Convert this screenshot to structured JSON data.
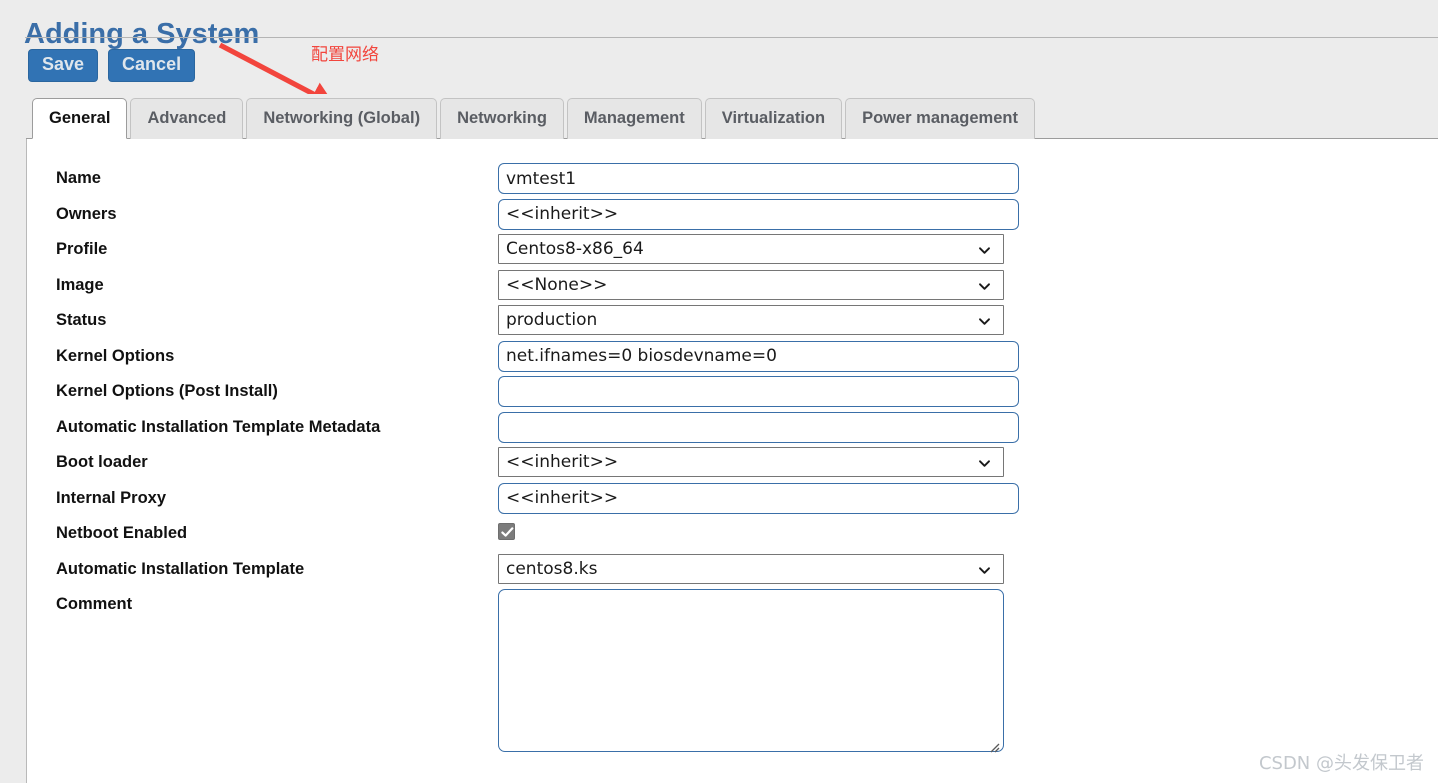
{
  "page": {
    "title": "Adding a System"
  },
  "toolbar": {
    "save_label": "Save",
    "cancel_label": "Cancel"
  },
  "annotation": {
    "text": "配置网络",
    "color": "#f2453d",
    "arrow": "red-arrow-icon"
  },
  "tabs": [
    {
      "label": "General",
      "active": true
    },
    {
      "label": "Advanced",
      "active": false
    },
    {
      "label": "Networking (Global)",
      "active": false
    },
    {
      "label": "Networking",
      "active": false
    },
    {
      "label": "Management",
      "active": false
    },
    {
      "label": "Virtualization",
      "active": false
    },
    {
      "label": "Power management",
      "active": false
    }
  ],
  "form": {
    "fields": [
      {
        "label": "Name",
        "type": "text",
        "value": "vmtest1",
        "placeholder": ""
      },
      {
        "label": "Owners",
        "type": "text",
        "value": "<<inherit>>",
        "placeholder": ""
      },
      {
        "label": "Profile",
        "type": "select",
        "value": "Centos8-x86_64"
      },
      {
        "label": "Image",
        "type": "select",
        "value": "<<None>>"
      },
      {
        "label": "Status",
        "type": "select",
        "value": "production"
      },
      {
        "label": "Kernel Options",
        "type": "text",
        "value": "net.ifnames=0 biosdevname=0",
        "placeholder": ""
      },
      {
        "label": "Kernel Options (Post Install)",
        "type": "text",
        "value": "",
        "placeholder": ""
      },
      {
        "label": "Automatic Installation Template Metadata",
        "type": "text",
        "value": "",
        "placeholder": ""
      },
      {
        "label": "Boot loader",
        "type": "select",
        "value": "<<inherit>>"
      },
      {
        "label": "Internal Proxy",
        "type": "text",
        "value": "<<inherit>>",
        "placeholder": ""
      },
      {
        "label": "Netboot Enabled",
        "type": "checkbox",
        "checked": true
      },
      {
        "label": "Automatic Installation Template",
        "type": "select",
        "value": "centos8.ks"
      },
      {
        "label": "Comment",
        "type": "textarea",
        "value": "",
        "placeholder": ""
      }
    ]
  },
  "watermark": {
    "text": "CSDN @头发保卫者"
  },
  "colors": {
    "title": "#3a6ea8",
    "button": "#3173b4",
    "annotation": "#f2453d",
    "input_border": "#3a6fa8",
    "select_border": "#767676",
    "page_bg": "#ececec"
  }
}
